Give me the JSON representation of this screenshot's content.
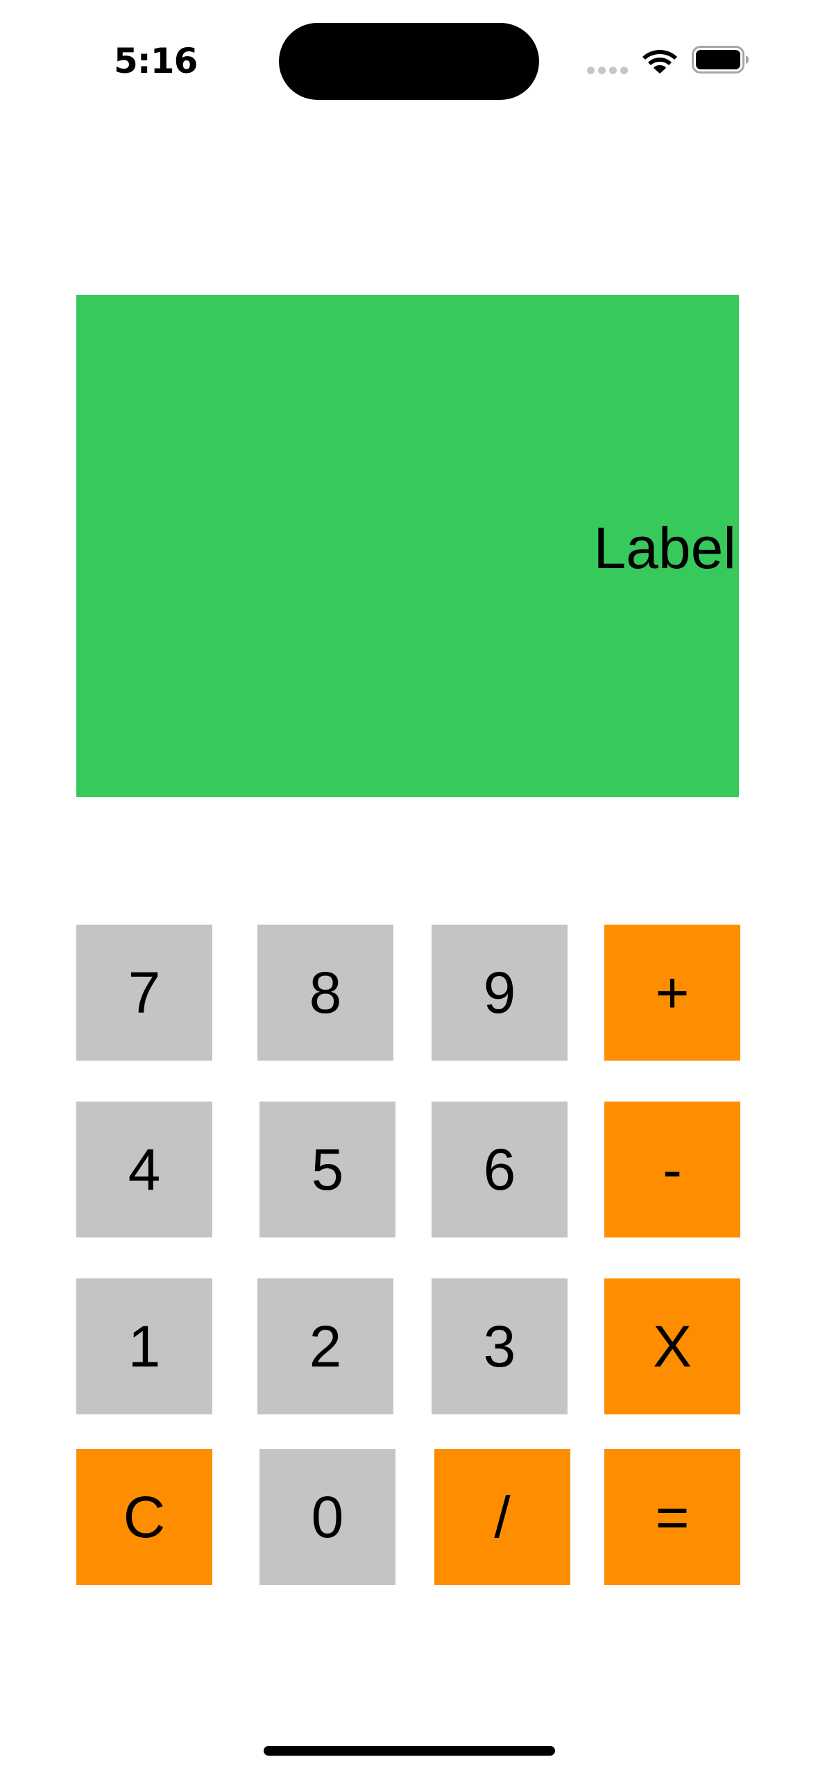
{
  "status_bar": {
    "time": "5:16",
    "icons": [
      "cellular-signal-icon",
      "wifi-icon",
      "battery-icon"
    ]
  },
  "display": {
    "label": "Label",
    "background_color": "#37c95b"
  },
  "keypad": {
    "key_7": "7",
    "key_8": "8",
    "key_9": "9",
    "key_plus": "+",
    "key_4": "4",
    "key_5": "5",
    "key_6": "6",
    "key_minus": "-",
    "key_1": "1",
    "key_2": "2",
    "key_3": "3",
    "key_multiply": "X",
    "key_clear": "C",
    "key_0": "0",
    "key_divide": "/",
    "key_equals": "=",
    "number_key_color": "#c4c4c6",
    "operator_key_color": "#fe8e00"
  }
}
